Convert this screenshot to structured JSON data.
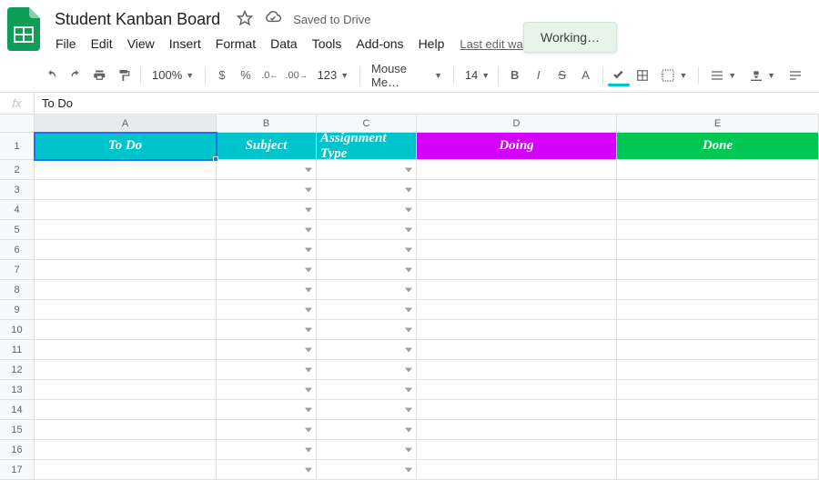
{
  "doc_title": "Student Kanban Board",
  "saved_text": "Saved to Drive",
  "working_badge": "Working…",
  "menus": [
    "File",
    "Edit",
    "View",
    "Insert",
    "Format",
    "Data",
    "Tools",
    "Add-ons",
    "Help"
  ],
  "last_edit": "Last edit wa",
  "toolbar": {
    "zoom": "100%",
    "currency": "$",
    "percent": "%",
    "dec_dec": ".0",
    "inc_dec": ".00",
    "more_fmt": "123",
    "font": "Mouse Me…",
    "font_size": "14",
    "bold": "B",
    "italic": "I",
    "strike": "S",
    "text_color": "A"
  },
  "formula": {
    "fx": "fx",
    "value": "To Do"
  },
  "columns": [
    "A",
    "B",
    "C",
    "D",
    "E"
  ],
  "row_count": 17,
  "header_row": {
    "A": {
      "text": "To Do",
      "bg": "todo-bg"
    },
    "B": {
      "text": "Subject",
      "bg": "subj-bg"
    },
    "C": {
      "text": "Assignment Type",
      "bg": "assn-bg"
    },
    "D": {
      "text": "Doing",
      "bg": "doing-bg"
    },
    "E": {
      "text": "Done",
      "bg": "done-bg"
    }
  },
  "dropdown_cols": [
    "B",
    "C"
  ],
  "active_cell": "A1",
  "colors": {
    "accent_cyan": "#00c4cc",
    "accent_magenta": "#d500f9",
    "accent_green": "#00c853",
    "selection": "#1a73e8"
  }
}
